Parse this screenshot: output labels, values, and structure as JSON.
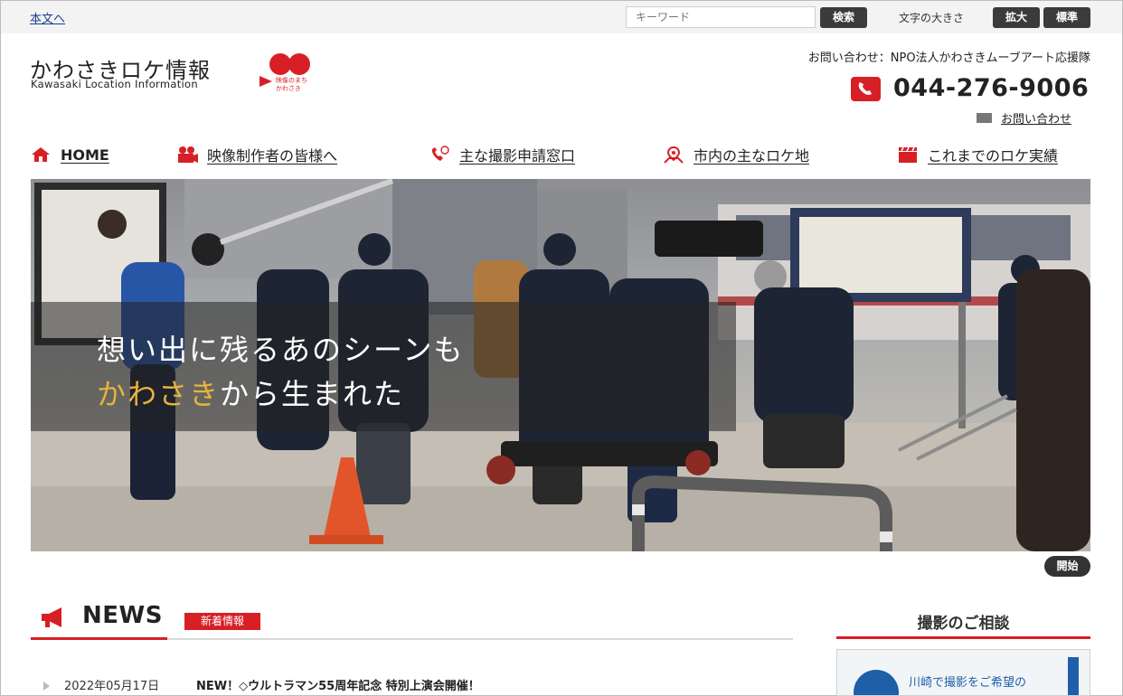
{
  "utility": {
    "skip_link": "本文へ",
    "search_placeholder": "キーワード",
    "search_button": "検索",
    "font_size_label": "文字の大きさ",
    "enlarge_button": "拡大",
    "standard_button": "標準"
  },
  "header": {
    "logo_jp": "かわさきロケ情報",
    "logo_en": "Kawasaki Location Information",
    "logo_mark_text_1": "映像のまち",
    "logo_mark_text_2": "かわさき",
    "contact_org": "お問い合わせ：NPO法人かわさきムーブアート応援隊",
    "phone": "044-276-9006",
    "inquiry_link": "お問い合わせ"
  },
  "nav": {
    "items": [
      {
        "label": "HOME",
        "icon": "home-icon"
      },
      {
        "label": "映像制作者の皆様へ",
        "icon": "camera-icon"
      },
      {
        "label": "主な撮影申請窓口",
        "icon": "phone-icon"
      },
      {
        "label": "市内の主なロケ地",
        "icon": "map-icon"
      },
      {
        "label": "これまでのロケ実績",
        "icon": "clapperboard-icon"
      }
    ]
  },
  "hero": {
    "line1": "想い出に残るあのシーンも",
    "line2_accent": "かわさき",
    "line2_rest": "から生まれた",
    "start_button": "開始"
  },
  "news": {
    "title": "NEWS",
    "badge": "新着情報",
    "items": [
      {
        "date": "2022年05月17日",
        "text": "NEW！◇ウルトラマン55周年記念 特別上演会開催！"
      }
    ]
  },
  "sidebar": {
    "consult_title": "撮影のご相談",
    "consult_text": "川崎で撮影をご希望の"
  },
  "colors": {
    "accent_red": "#d81f26",
    "hero_accent": "#e7b43b",
    "link_blue": "#1a3c8a"
  }
}
